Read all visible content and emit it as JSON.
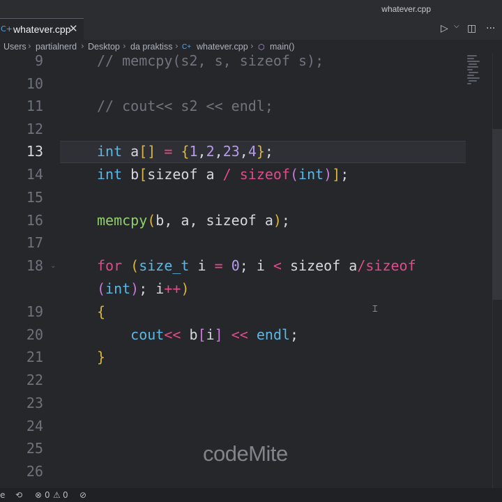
{
  "window": {
    "title": "whatever.cpp"
  },
  "tab": {
    "icon_text": "C+",
    "label": "whatever.cpp",
    "close_glyph": "✕"
  },
  "actions": {
    "run_glyph": "▷",
    "run_dropdown": "⌵",
    "split_glyph": "◫",
    "more_glyph": "···"
  },
  "breadcrumb": {
    "items": [
      "Users",
      "partialnerd",
      "Desktop",
      "da praktiss",
      "whatever.cpp",
      "main()"
    ],
    "file_icon": "C+",
    "symbol_icon": "⬡"
  },
  "editor": {
    "lines": [
      {
        "n": "9",
        "t": "// memcpy(s2, s, sizeof s);"
      },
      {
        "n": "10",
        "t": ""
      },
      {
        "n": "11",
        "t": "// cout<< s2 << endl;"
      },
      {
        "n": "12",
        "t": ""
      },
      {
        "n": "13",
        "t": "int a[] = {1,2,23,4};"
      },
      {
        "n": "14",
        "t": "int b[sizeof a / sizeof(int)];"
      },
      {
        "n": "15",
        "t": ""
      },
      {
        "n": "16",
        "t": "memcpy(b, a, sizeof a);"
      },
      {
        "n": "17",
        "t": ""
      },
      {
        "n": "18",
        "t": "for (size_t i = 0; i < sizeof a/sizeof"
      },
      {
        "n": "",
        "t": "(int); i++)"
      },
      {
        "n": "19",
        "t": "{"
      },
      {
        "n": "20",
        "t": "    cout<< b[i] << endl;"
      },
      {
        "n": "21",
        "t": "}"
      },
      {
        "n": "22",
        "t": ""
      },
      {
        "n": "23",
        "t": ""
      },
      {
        "n": "24",
        "t": ""
      },
      {
        "n": "25",
        "t": ""
      },
      {
        "n": "26",
        "t": ""
      }
    ],
    "active_line": "13"
  },
  "watermark": "codeMite",
  "statusbar": {
    "left_partial": "e",
    "errors": "0",
    "warnings": "0",
    "remote_glyph": "⟲",
    "error_glyph": "⊗",
    "warning_glyph": "⚠",
    "bell_glyph": "⊘"
  },
  "colors": {
    "background": "#25272b",
    "keyword": "#5bb8e6",
    "comment": "#6f747d",
    "function": "#8fd06a",
    "operator": "#e04b8c",
    "number": "#b79be8"
  }
}
